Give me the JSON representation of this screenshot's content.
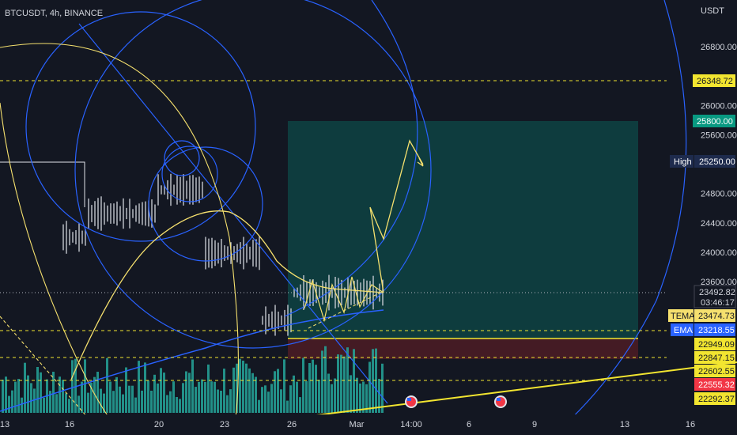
{
  "header": {
    "symbol_title": "BTCUSDT, 4h, BINANCE"
  },
  "price_axis": {
    "currency": "USDT",
    "ticks": [
      "26800.00",
      "26000.00",
      "25600.00",
      "24800.00",
      "24400.00",
      "24000.00",
      "23600.00"
    ],
    "tick_values": [
      26800,
      26000,
      25600,
      24800,
      24400,
      24000,
      23600
    ]
  },
  "price_labels": {
    "level_top": "26348.72",
    "target": "25800.00",
    "high_tag": "High",
    "high_value": "25250.00",
    "current_price": "23492.82",
    "countdown": "03:46:17",
    "tema_tag": "TEMA",
    "tema_value": "23474.73",
    "ema_tag": "EMA",
    "ema_value": "23218.55",
    "level_1": "22949.09",
    "level_2": "22847.15",
    "level_3": "22602.55",
    "stop": "22555.32",
    "level_4": "22292.37"
  },
  "time_axis": {
    "ticks": [
      "13",
      "16",
      "20",
      "23",
      "26",
      "Mar",
      "14:00",
      "6",
      "9",
      "13",
      "16"
    ]
  },
  "colors": {
    "background": "#131722",
    "candle": "#d1d4dc",
    "volume": "#26a69a",
    "fib_circles": "#2962ff",
    "tema": "#f5e06e",
    "ema": "#2962ff",
    "target_zone": "#0d4a48",
    "stop_zone": "#4a1c25",
    "level_line": "#f2e530",
    "stop_label": "#f23645",
    "target_label": "#089981",
    "high_label": "#1e2b4d",
    "ema_label": "#2962ff"
  },
  "icons": {
    "event_flag_icon": "us-flag-event-marker"
  }
}
